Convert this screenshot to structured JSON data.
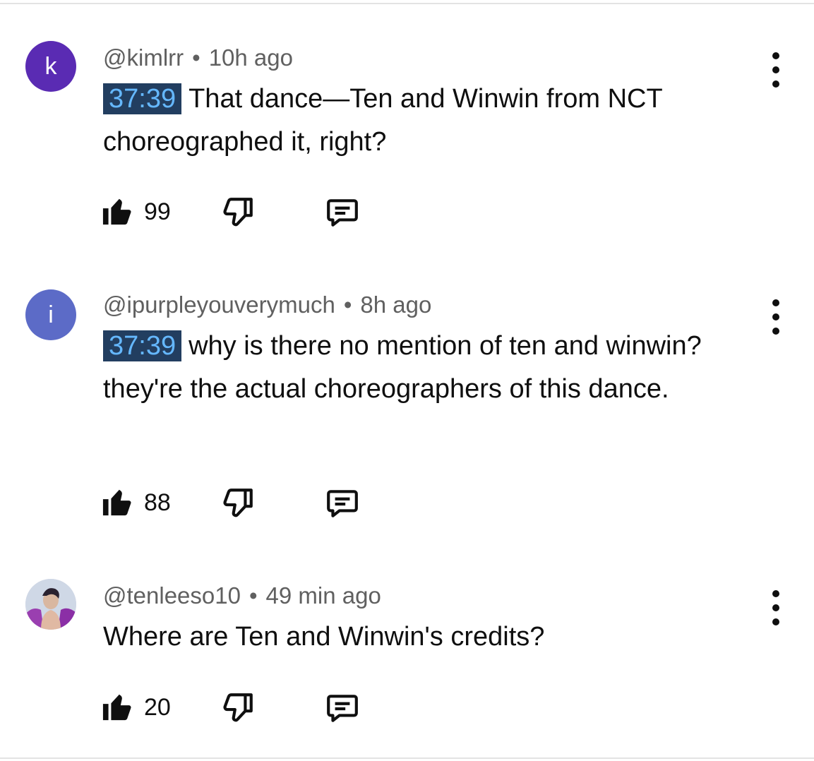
{
  "comments": [
    {
      "avatar_letter": "k",
      "avatar_color": "#5a2bb3",
      "handle": "@kimlrr",
      "time": "10h ago",
      "timestamp": "37:39",
      "text": "That dance—Ten and Winwin from NCT choreographed it, right?",
      "likes": "99"
    },
    {
      "avatar_letter": "i",
      "avatar_color": "#5c6bc7",
      "handle": "@ipurpleyouverymuch",
      "time": "8h ago",
      "timestamp": "37:39",
      "text": "why is there no mention of ten and winwin? they're the actual choreographers of this dance.",
      "likes": "88"
    },
    {
      "avatar_letter": "",
      "avatar_color": "#8a6fb0",
      "handle": "@tenleeso10",
      "time": "49 min ago",
      "timestamp": "",
      "text": "Where are Ten and Winwin's credits?",
      "likes": "20"
    }
  ],
  "meta_separator": "•",
  "colors": {
    "timestamp_bg": "#223e60",
    "timestamp_fg": "#65b8ff",
    "meta": "#606060"
  },
  "icons": [
    "thumbs-up-icon",
    "thumbs-down-icon",
    "reply-icon",
    "more-vert-icon"
  ]
}
